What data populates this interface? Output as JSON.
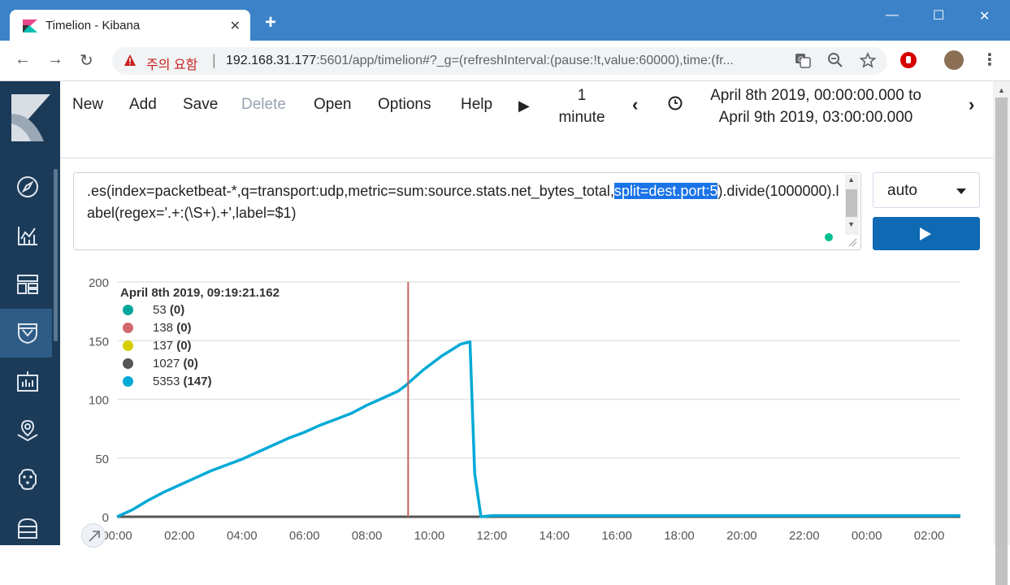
{
  "browser": {
    "tab_title": "Timelion - Kibana",
    "tab_close": "✕",
    "new_tab": "+",
    "window_controls": {
      "minimize": "—",
      "maximize": "☐",
      "close": "✕"
    },
    "nav": {
      "back": "←",
      "forward": "→",
      "reload": "↻"
    },
    "security_warning": "주의 요함",
    "url_host": "192.168.31.177",
    "url_rest": ":5601/app/timelion#?_g=(refreshInterval:(pause:!t,value:60000),time:(fr...",
    "icons": [
      "translate-icon",
      "zoom-icon",
      "bookmark-star-icon",
      "adblock-icon",
      "profile-avatar",
      "menu-dots-icon"
    ]
  },
  "sidebar": {
    "items": [
      {
        "name": "discover",
        "icon": "compass-icon",
        "active": false
      },
      {
        "name": "visualize",
        "icon": "visualize-icon",
        "active": false
      },
      {
        "name": "dashboard",
        "icon": "dashboard-icon",
        "active": false
      },
      {
        "name": "timelion",
        "icon": "timelion-icon",
        "active": true
      },
      {
        "name": "canvas",
        "icon": "canvas-icon",
        "active": false
      },
      {
        "name": "maps",
        "icon": "maps-icon",
        "active": false
      },
      {
        "name": "ml",
        "icon": "ml-icon",
        "active": false
      },
      {
        "name": "infrastructure",
        "icon": "infrastructure-icon",
        "active": false
      }
    ]
  },
  "menu": {
    "new": "New",
    "add": "Add",
    "save": "Save",
    "delete": "Delete",
    "open": "Open",
    "options": "Options",
    "help": "Help",
    "interval_line1": "1",
    "interval_line2": "minute",
    "time_from": "April 8th 2019, 00:00:00.000 to",
    "time_to": "April 9th 2019, 03:00:00.000"
  },
  "editor": {
    "before": ".es(index=packetbeat-*,q=transport:udp,metric=sum:source.stats.net_bytes_total,",
    "selected": "split=dest.port:5",
    "after": ").divide(1000000).label(regex='.+:(\\S+).+',label=$1)"
  },
  "interval_select": {
    "value": "auto"
  },
  "legend": {
    "title": "April 8th 2019, 09:19:21.162",
    "items": [
      {
        "name": "53",
        "value": "(0)",
        "color": "#00a69b"
      },
      {
        "name": "138",
        "value": "(0)",
        "color": "#d36a6a"
      },
      {
        "name": "137",
        "value": "(0)",
        "color": "#d6cf00"
      },
      {
        "name": "1027",
        "value": "(0)",
        "color": "#555555"
      },
      {
        "name": "5353",
        "value": "(147)",
        "color": "#00a9d6"
      }
    ]
  },
  "chart_data": {
    "type": "line",
    "title": "",
    "xlabel": "",
    "ylabel": "",
    "ylim": [
      0,
      200
    ],
    "yticks": [
      0,
      50,
      100,
      150,
      200
    ],
    "xlim": [
      0,
      27
    ],
    "xtick_values": [
      0,
      2,
      4,
      6,
      8,
      10,
      12,
      14,
      16,
      18,
      20,
      22,
      24,
      26
    ],
    "xtick_labels": [
      "00:00",
      "02:00",
      "04:00",
      "06:00",
      "08:00",
      "10:00",
      "12:00",
      "14:00",
      "16:00",
      "18:00",
      "20:00",
      "22:00",
      "00:00",
      "02:00"
    ],
    "grid": true,
    "legend_position": "top-left",
    "cursor_x": 9.32,
    "cursor_color": "#c9625f",
    "series": [
      {
        "name": "53",
        "color": "#00a69b",
        "points": [
          [
            0,
            0
          ],
          [
            27,
            0
          ]
        ]
      },
      {
        "name": "138",
        "color": "#d36a6a",
        "points": [
          [
            0,
            0
          ],
          [
            27,
            0
          ]
        ]
      },
      {
        "name": "137",
        "color": "#d6cf00",
        "points": [
          [
            0,
            0
          ],
          [
            27,
            0
          ]
        ]
      },
      {
        "name": "1027",
        "color": "#555555",
        "points": [
          [
            0,
            0
          ],
          [
            9.7,
            0
          ],
          [
            27,
            0
          ]
        ]
      },
      {
        "name": "5353",
        "color": "#00a9d6",
        "points": [
          [
            0,
            0
          ],
          [
            0.5,
            6
          ],
          [
            1,
            14
          ],
          [
            1.5,
            21
          ],
          [
            2,
            27
          ],
          [
            2.5,
            33
          ],
          [
            3,
            39
          ],
          [
            3.5,
            44
          ],
          [
            4,
            49
          ],
          [
            4.5,
            55
          ],
          [
            5,
            61
          ],
          [
            5.5,
            67
          ],
          [
            6,
            72
          ],
          [
            6.5,
            78
          ],
          [
            7,
            83
          ],
          [
            7.5,
            88
          ],
          [
            8,
            95
          ],
          [
            8.5,
            101
          ],
          [
            9,
            107
          ],
          [
            9.25,
            112
          ],
          [
            9.5,
            118
          ],
          [
            9.8,
            125
          ],
          [
            10.1,
            131
          ],
          [
            10.4,
            137
          ],
          [
            10.7,
            142
          ],
          [
            11,
            147
          ],
          [
            11.3,
            149
          ],
          [
            11.45,
            37
          ],
          [
            11.65,
            0
          ],
          [
            12,
            1
          ],
          [
            13,
            1
          ],
          [
            27,
            1
          ]
        ]
      }
    ]
  }
}
